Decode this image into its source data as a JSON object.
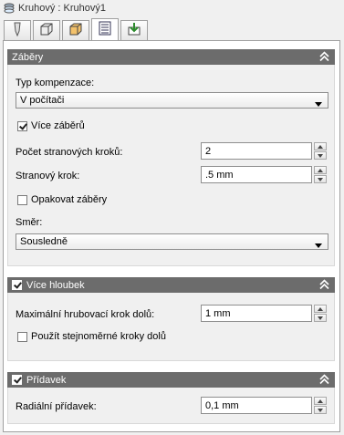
{
  "window": {
    "title": "Kruhový : Kruhový1",
    "icon": "layers-icon"
  },
  "tabs": [
    {
      "icon": "tool-icon"
    },
    {
      "icon": "stock-box-icon"
    },
    {
      "icon": "heights-box-icon"
    },
    {
      "icon": "passes-icon",
      "active": true
    },
    {
      "icon": "linking-icon"
    }
  ],
  "sections": {
    "passes": {
      "title": "Záběry",
      "comp_type_label": "Typ kompenzace:",
      "comp_type_value": "V počítači",
      "multiple_passes_label": "Více záběrů",
      "multiple_passes_checked": true,
      "stepover_count_label": "Počet stranových kroků:",
      "stepover_count_value": "2",
      "stepover_label": "Stranový krok:",
      "stepover_value": ".5 mm",
      "repeat_passes_label": "Opakovat záběry",
      "repeat_passes_checked": false,
      "direction_label": "Směr:",
      "direction_value": "Sousledně"
    },
    "depths": {
      "title": "Více hloubek",
      "enabled": true,
      "max_step_label": "Maximální hrubovací krok dolů:",
      "max_step_value": "1 mm",
      "even_steps_label": "Použít stejnoměrné kroky dolů",
      "even_steps_checked": false
    },
    "stock": {
      "title": "Přídavek",
      "enabled": true,
      "radial_label": "Radiální přídavek:",
      "radial_value": "0,1 mm"
    }
  },
  "colors": {
    "section_header": "#6c6c6c",
    "panel_bg": "#f0f0f0"
  }
}
